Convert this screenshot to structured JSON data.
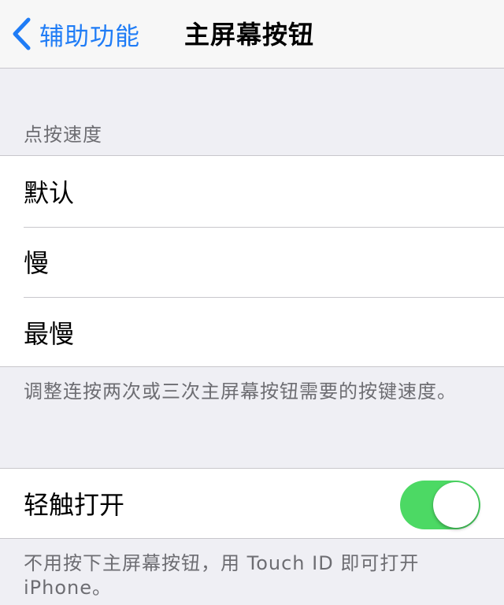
{
  "navbar": {
    "back_label": "辅助功能",
    "title": "主屏幕按钮"
  },
  "click_speed": {
    "header": "点按速度",
    "options": [
      {
        "label": "默认"
      },
      {
        "label": "慢"
      },
      {
        "label": "最慢"
      }
    ],
    "footer": "调整连按两次或三次主屏幕按钮需要的按键速度。"
  },
  "rest_finger": {
    "label": "轻触打开",
    "enabled": true,
    "footer": "不用按下主屏幕按钮，用 Touch ID 即可打开 iPhone。"
  },
  "colors": {
    "accent": "#1f7cf6",
    "switch_on": "#4cd964",
    "background": "#efeff4"
  },
  "icons": {
    "back": "chevron-left-icon"
  }
}
